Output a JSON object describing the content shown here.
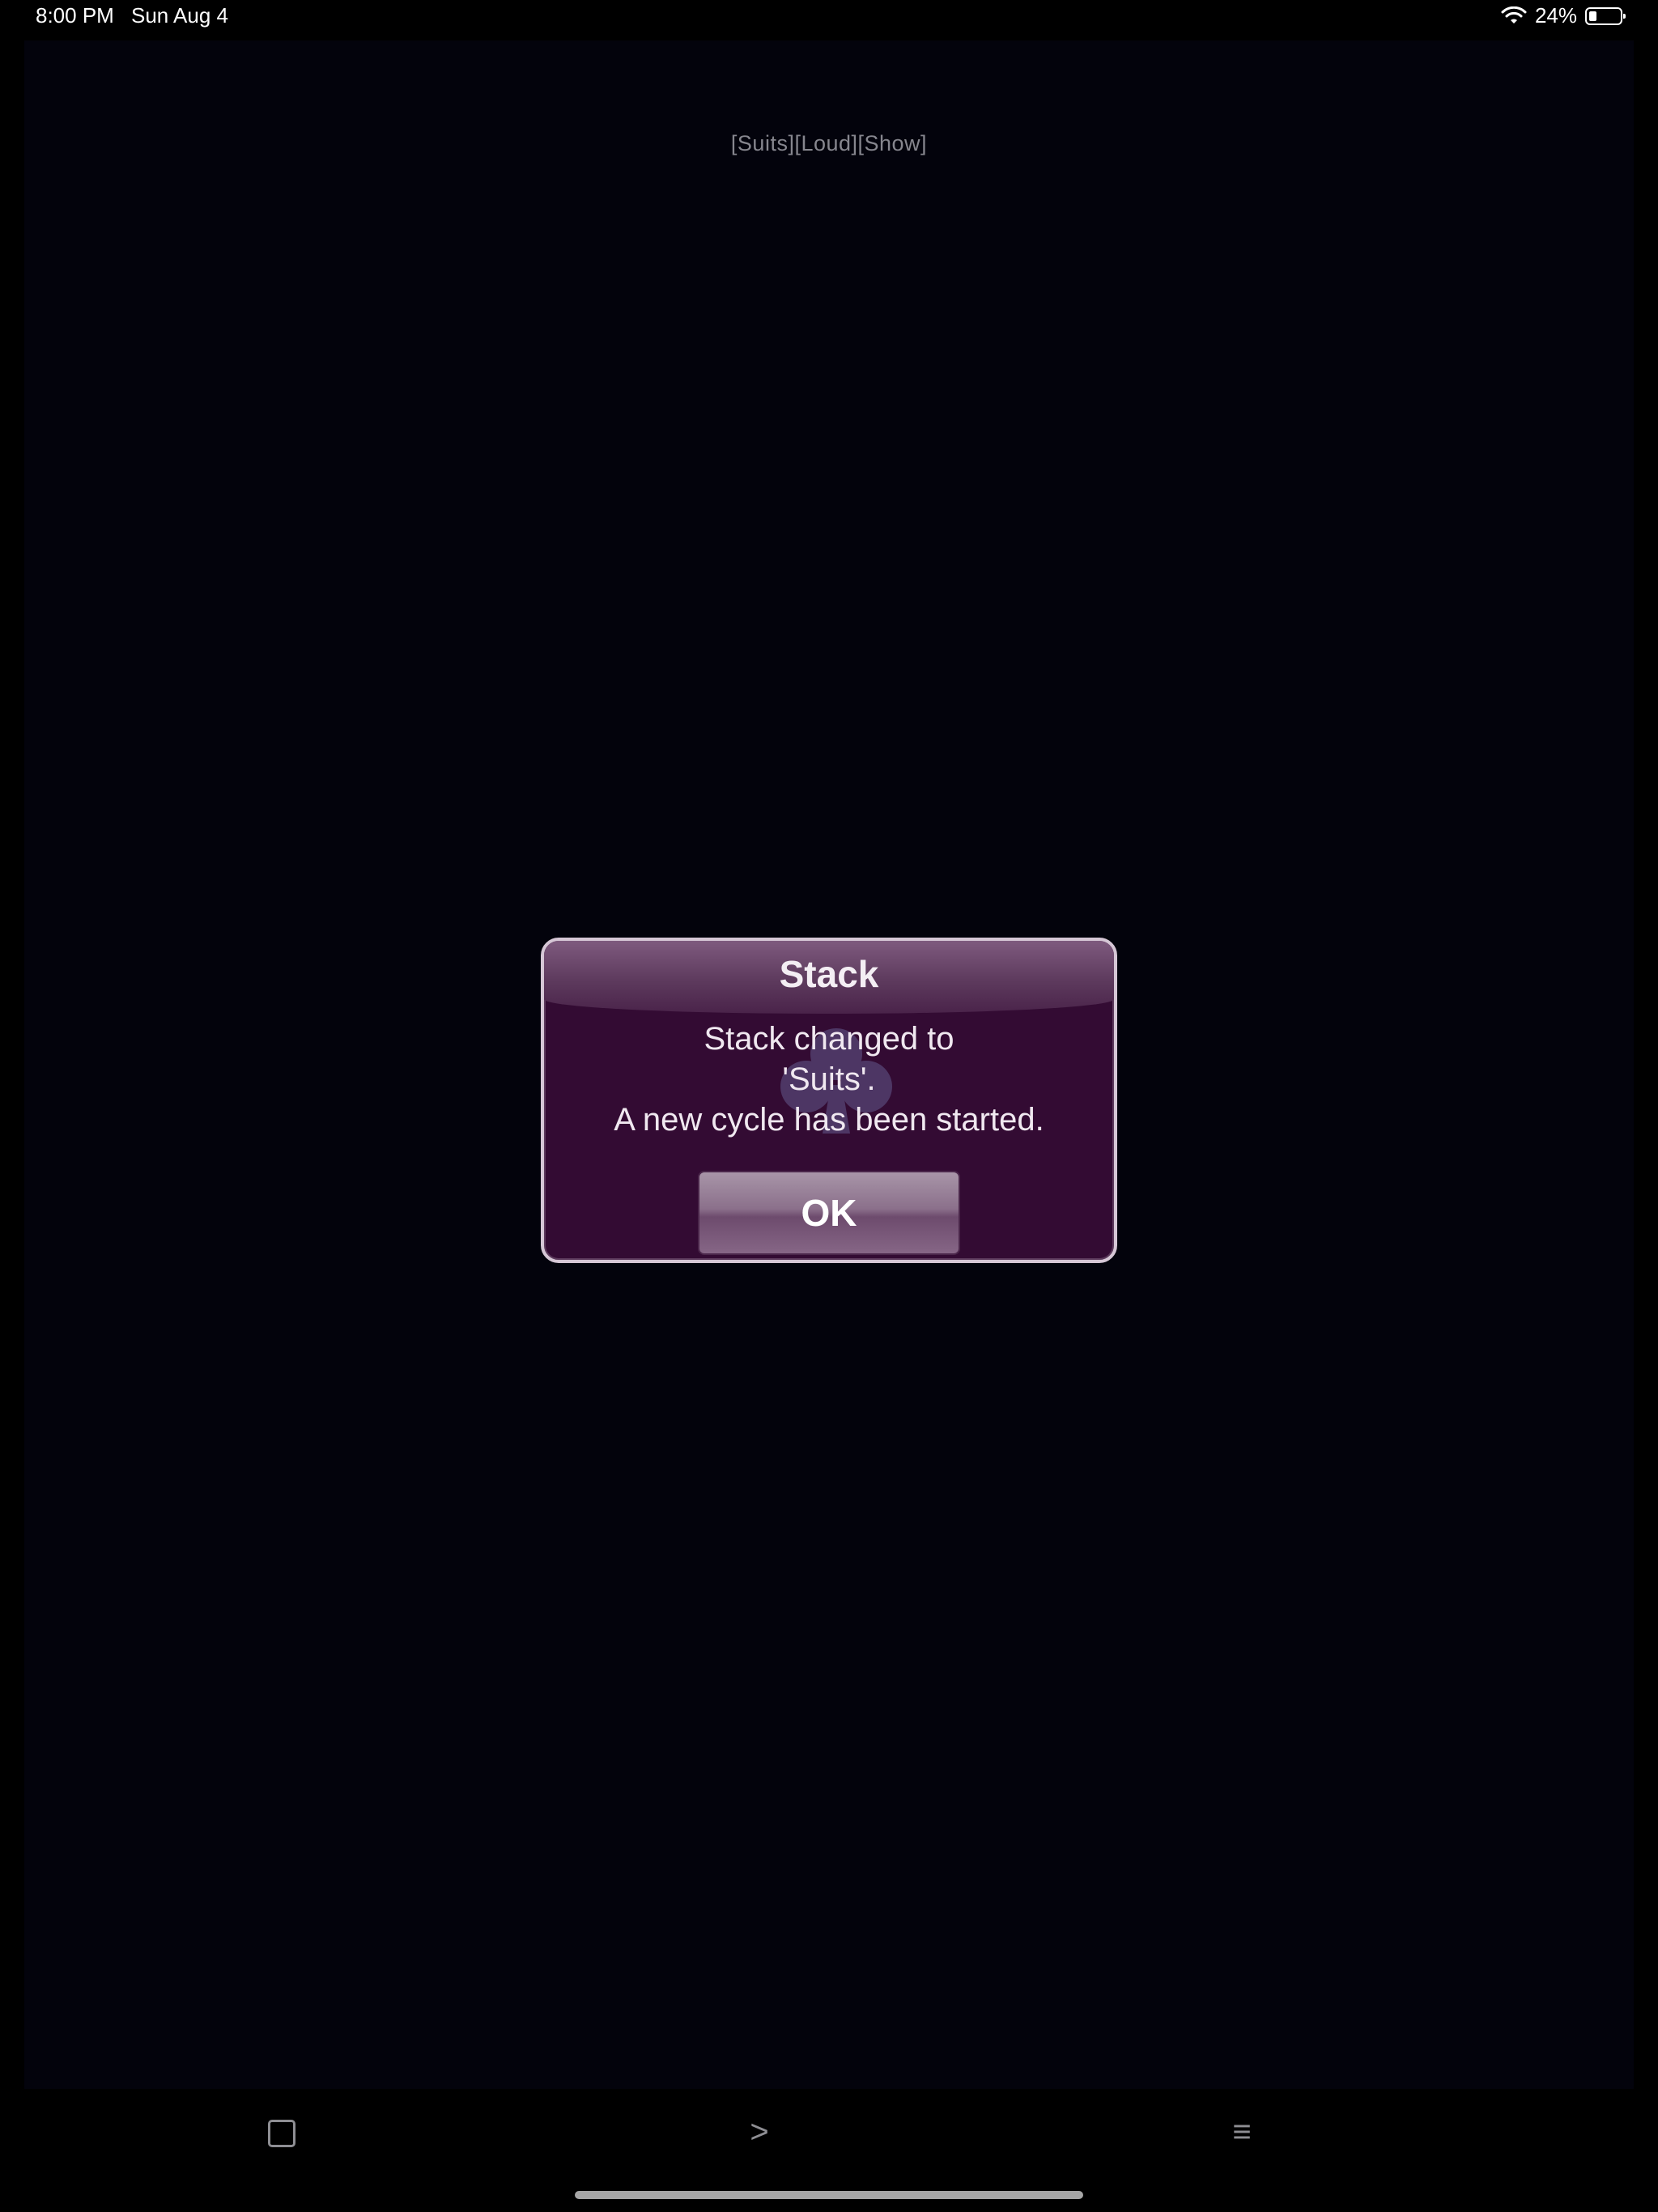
{
  "status_bar": {
    "time": "8:00 PM",
    "date": "Sun Aug 4",
    "battery_percent": "24%",
    "battery_level": 0.24
  },
  "game": {
    "mode_label": "[Suits][Loud][Show]"
  },
  "dialog": {
    "title": "Stack",
    "message_line1": "Stack changed to",
    "message_line2": "'Suits'.",
    "message_line3": "A new cycle has been started.",
    "ok_label": "OK"
  },
  "toolbar": {
    "next_label": ">",
    "menu_label": "≡"
  },
  "colors": {
    "dialog_bg": "#330b33",
    "dialog_border": "#d6c7d6",
    "background": "#03030c"
  }
}
